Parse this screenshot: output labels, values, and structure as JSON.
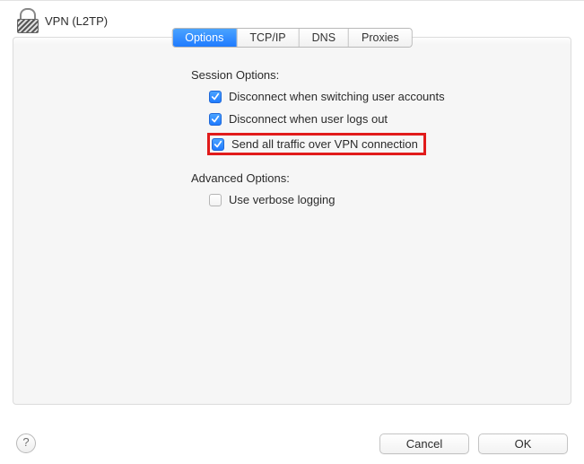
{
  "header": {
    "title": "VPN (L2TP)"
  },
  "tabs": {
    "options": "Options",
    "tcpip": "TCP/IP",
    "dns": "DNS",
    "proxies": "Proxies"
  },
  "sections": {
    "session_heading": "Session Options:",
    "advanced_heading": "Advanced Options:"
  },
  "options": {
    "disconnect_switch_user": {
      "label": "Disconnect when switching user accounts",
      "checked": true
    },
    "disconnect_logout": {
      "label": "Disconnect when user logs out",
      "checked": true
    },
    "send_all_traffic": {
      "label": "Send all traffic over VPN connection",
      "checked": true,
      "highlighted": true
    },
    "verbose_logging": {
      "label": "Use verbose logging",
      "checked": false
    }
  },
  "buttons": {
    "help": "?",
    "cancel": "Cancel",
    "ok": "OK"
  }
}
